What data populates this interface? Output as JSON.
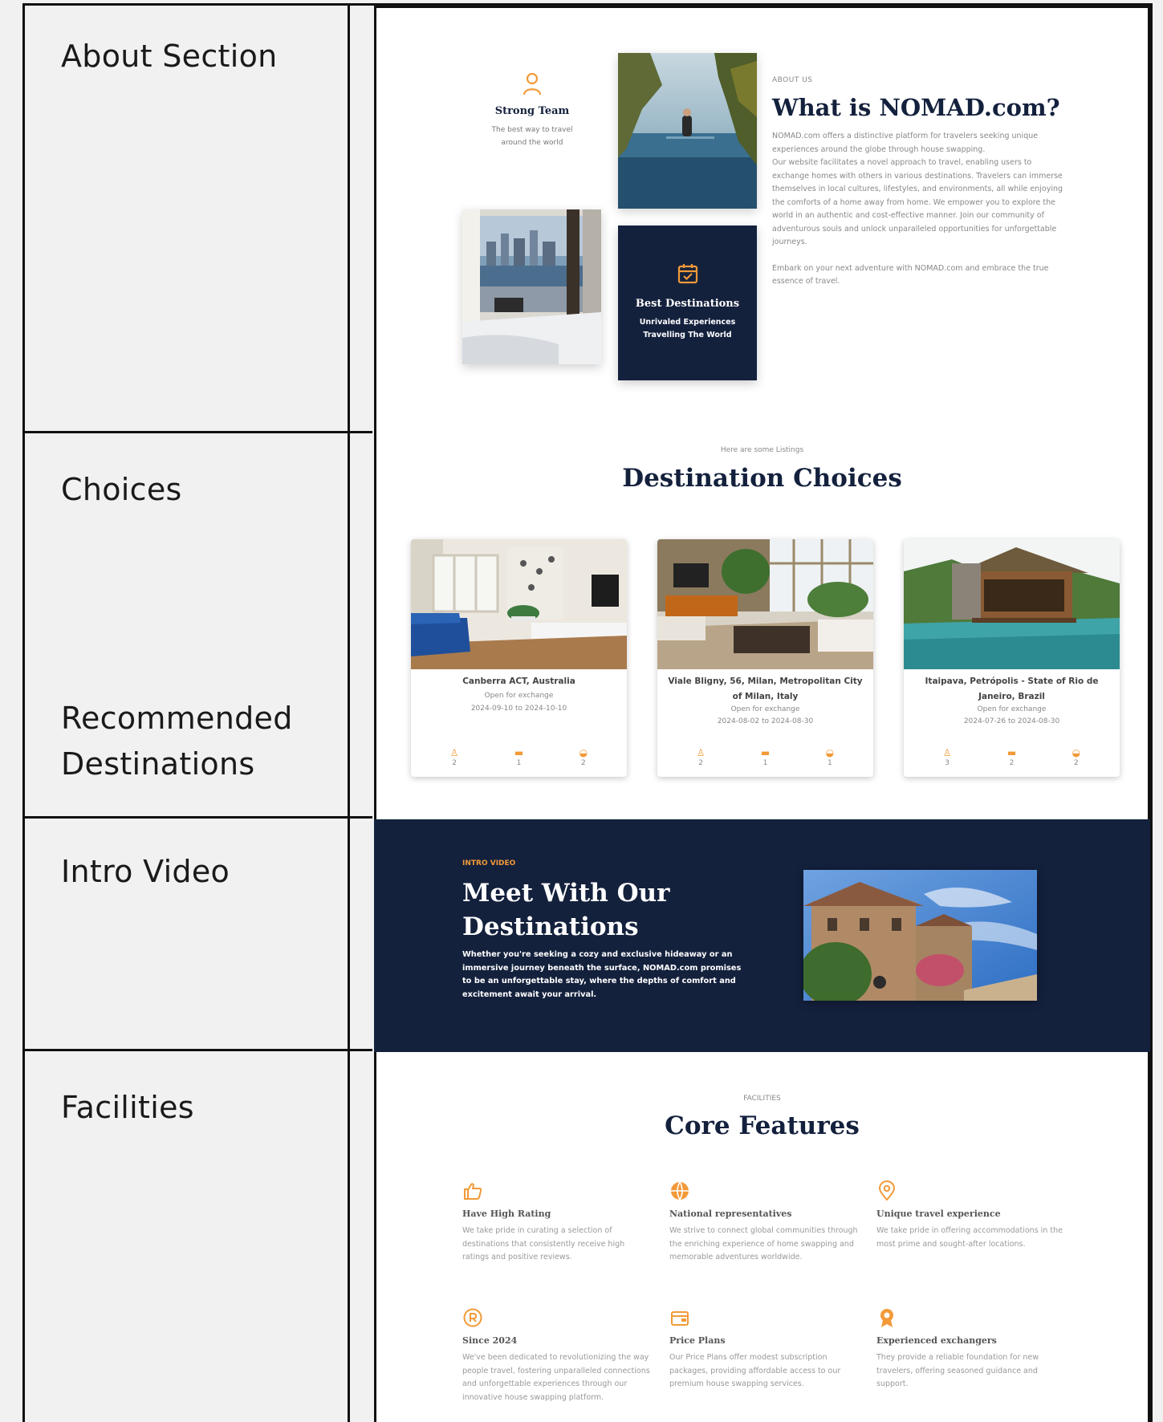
{
  "labels": {
    "about": "About Section",
    "choices": "Choices",
    "recommended": "Recommended Destinations",
    "intro": "Intro Video",
    "facilities": "Facilities"
  },
  "about": {
    "team_title": "Strong Team",
    "team_text_1": "The best way to travel",
    "team_text_2": "around the world",
    "dest_title": "Best Destinations",
    "dest_text_1": "Unrivaled Experiences",
    "dest_text_2": "Travelling The World",
    "eyebrow": "ABOUT US",
    "heading": "What is NOMAD.com?",
    "para_1": "NOMAD.com offers a distinctive platform for travelers seeking unique experiences around the globe through house swapping.",
    "para_2": "Our website facilitates a novel approach to travel, enabling users to exchange homes with others in various destinations. Travelers can immerse themselves in local cultures, lifestyles, and environments, all while enjoying the comforts of a home away from home. We empower you to explore the world in an authentic and cost-effective manner. Join our community of adventurous souls and unlock unparalleled opportunities for unforgettable journeys.",
    "para_3": "Embark on your next adventure with NOMAD.com and embrace the true essence of travel."
  },
  "choices": {
    "eyebrow": "Here are some Listings",
    "heading": "Destination Choices",
    "listings": [
      {
        "title": "Canberra ACT, Australia",
        "status": "Open for exchange",
        "dates": "2024-09-10 to 2024-10-10",
        "guests": "2",
        "beds": "1",
        "baths": "2"
      },
      {
        "title": "Viale Bligny, 56, Milan, Metropolitan City of Milan, Italy",
        "status": "Open for exchange",
        "dates": "2024-08-02 to 2024-08-30",
        "guests": "2",
        "beds": "1",
        "baths": "1"
      },
      {
        "title": "Itaipava, Petrópolis - State of Rio de Janeiro, Brazil",
        "status": "Open for exchange",
        "dates": "2024-07-26 to 2024-08-30",
        "guests": "3",
        "beds": "2",
        "baths": "2"
      }
    ]
  },
  "intro": {
    "eyebrow": "INTRO VIDEO",
    "heading": "Meet With Our Destinations",
    "text": "Whether you're seeking a cozy and exclusive hideaway or an immersive journey beneath the surface, NOMAD.com promises to be an unforgettable stay, where the depths of comfort and excitement await your arrival."
  },
  "facilities": {
    "eyebrow": "FACILITIES",
    "heading": "Core Features",
    "features": [
      {
        "name": "Have High Rating",
        "desc": "We take pride in curating a selection of destinations that consistently receive high ratings and positive reviews.",
        "icon": "thumbs-up-icon"
      },
      {
        "name": "National representatives",
        "desc": "We strive to connect global communities through the enriching experience of home swapping and memorable adventures worldwide.",
        "icon": "globe-icon"
      },
      {
        "name": "Unique travel experience",
        "desc": "We take pride in offering accommodations in the most prime and sought-after locations.",
        "icon": "map-pin-icon"
      },
      {
        "name": "Since 2024",
        "desc": "We've been dedicated to revolutionizing the way people travel, fostering unparalleled connections and unforgettable experiences through our innovative house swapping platform.",
        "icon": "registered-icon"
      },
      {
        "name": "Price Plans",
        "desc": "Our Price Plans offer modest subscription packages, providing affordable access to our premium house swapping services.",
        "icon": "wallet-icon"
      },
      {
        "name": "Experienced exchangers",
        "desc": "They provide a reliable foundation for new travelers, offering seasoned guidance and support.",
        "icon": "award-icon"
      }
    ]
  },
  "colors": {
    "navy": "#14213d",
    "accent": "#f29a38"
  }
}
